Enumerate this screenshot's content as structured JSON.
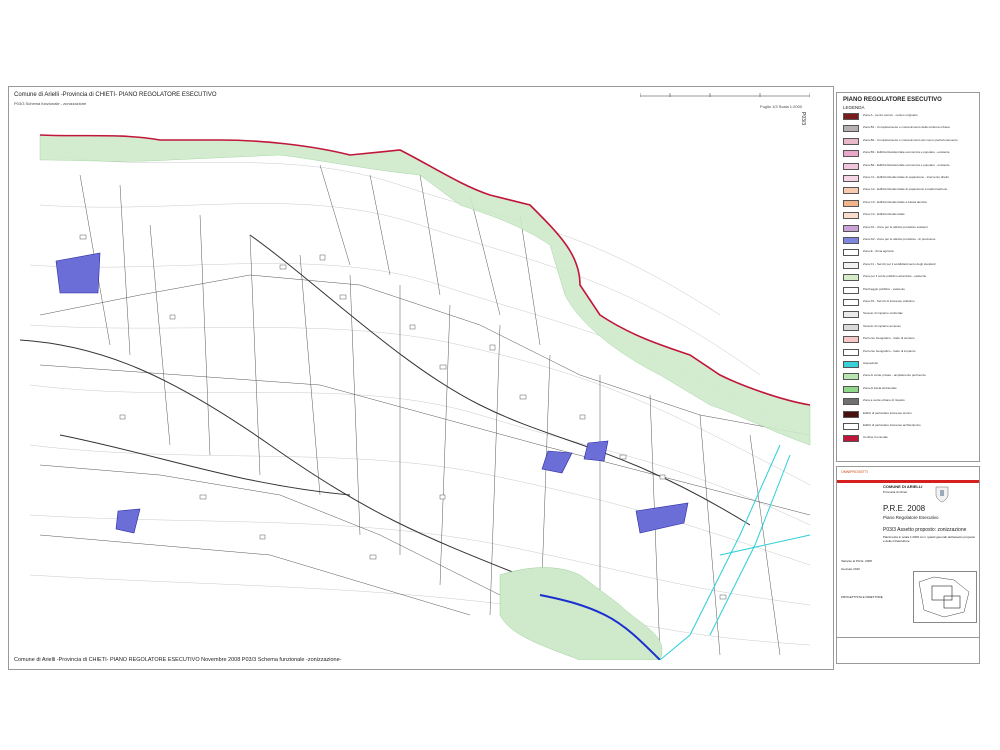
{
  "header": {
    "title": "Comune di Arielli -Provincia di CHIETI- PIANO REGOLATORE ESECUTIVO",
    "subtitle": "P03/3 Schema funzionale - zonizzazione",
    "sheet": "Foglio 1/3 Scala 1:2000",
    "code": "P03/3"
  },
  "footer": "Comune di Arielli -Provincia di CHIETI- PIANO REGOLATORE ESECUTIVO Novembre 2008 P03/3 Schema funzionale -zonizzazione-",
  "legend": {
    "title": "PIANO REGOLATORE ESECUTIVO",
    "head": "LEGENDA",
    "items": [
      {
        "label": "Zona A - centro storico - nucleo originario",
        "color": "#7a1d1d"
      },
      {
        "label": "Zona B1 - Completamento e mantenimento della struttura urbana",
        "color": "#b8b0b0"
      },
      {
        "label": "Zona B2 - Completamento e mantenimento del nuovo perfezionamento",
        "color": "#e8b7c8"
      },
      {
        "label": "Zona B3 - Edilizia Residenziale economica e popolare - esistente",
        "color": "#e9a7c9"
      },
      {
        "label": "Zona B4 - Edilizia Residenziale economica e popolare - esistente",
        "color": "#f0c5dd"
      },
      {
        "label": "Zona C1 - Edilizia Residenziale di espansione - intervento diretto",
        "color": "#f7d4e6"
      },
      {
        "label": "Zona C2 - Edilizia Residenziale di espansione a trasformazione",
        "color": "#f8cbb0"
      },
      {
        "label": "Zona C3 - Edilizia Residenziale a bassa densita",
        "color": "#f4b48a"
      },
      {
        "label": "Zona C4 - Edilizia Residenziale",
        "color": "#f9dccb"
      },
      {
        "label": "Zona D1 - Zone per le attivita produttive esistenti",
        "color": "#c9a3d8"
      },
      {
        "label": "Zona D2 - Zone per le attivita produttive - di previsione",
        "color": "#7f86e0"
      },
      {
        "label": "Zona E - Zona agricola",
        "color": "#ffffff"
      },
      {
        "label": "Zona F1 - Servizi per il soddisfacimento degli standard",
        "color": "#f2f2f2"
      },
      {
        "label": "Zona per il verde pubblico attrezzato - esistente",
        "color": "#d6ecc8"
      },
      {
        "label": "Parcheggio pubblico - esistente",
        "color": "#ffffff"
      },
      {
        "label": "Zona F6 - Servizi di interesse collettivo",
        "color": "#ffffff"
      },
      {
        "label": "Tessuto di impianto strutturale",
        "color": "#eaeaea"
      },
      {
        "label": "Tessuto di impianto annesso",
        "color": "#d9d9d9"
      },
      {
        "label": "Percorso Geografico - tratto di sentiero",
        "color": "#f7c6c6"
      },
      {
        "label": "Percorso Geografico - tratto di impianto",
        "color": "#ffffff"
      },
      {
        "label": "Acquedotto",
        "color": "#3ad0d8"
      },
      {
        "label": "Zona di verde privato - ampliamento pertinenze",
        "color": "#b9e6b0"
      },
      {
        "label": "Zona di tutela ambientale",
        "color": "#8fd88a"
      },
      {
        "label": "Zona a verde urbano di rispetto",
        "color": "#707070"
      },
      {
        "label": "Edifici di particolare interesse storico",
        "color": "#4a1010"
      },
      {
        "label": "Edifici di particolare interesse architettonico",
        "color": "#ffffff"
      },
      {
        "label": "Confine Comunale",
        "color": "#c0163a"
      }
    ]
  },
  "titleblock": {
    "studio": "OMNIPROGETTI",
    "comune": "COMUNE DI ARIELLI",
    "provincia": "Provincia di Chieti",
    "pre": "P.R.E. 2008",
    "pre_sub": "Piano Regolatore Esecutivo",
    "p03": "P03/3 Assetto proposto: zonizzazione",
    "p03_desc": "Planimetria in scala 1:2000 con i quadri generali dell'assetto proposto e delle infrastrutture",
    "variante": "Variante al P.R.E. 2008",
    "date": "Gennaio 2010",
    "rif": "PROGETTISTA E DIRETTORE"
  },
  "colors": {
    "boundary": "#c0163a",
    "green_zone": "#cfeacb",
    "blue_zone": "#6c6ed8",
    "river": "#1b2fd0",
    "aqueduct": "#2ad0d8",
    "road": "#444444"
  }
}
